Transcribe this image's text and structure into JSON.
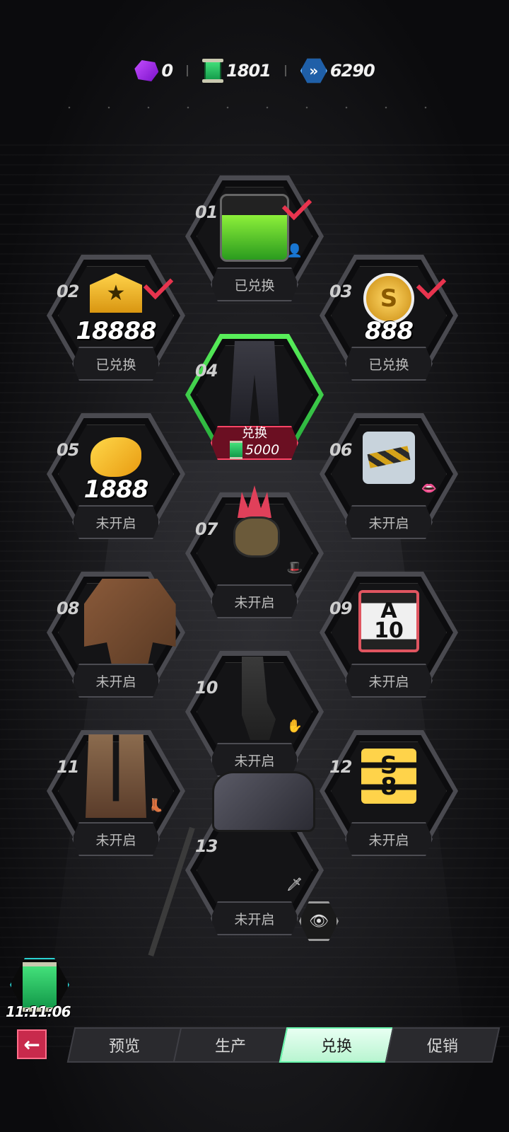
{
  "currencies": [
    {
      "icon": "purple-gem-icon",
      "value": "0"
    },
    {
      "icon": "green-scroll-icon",
      "value": "1801"
    },
    {
      "icon": "blue-chevron-token-icon",
      "value": "6290"
    }
  ],
  "items": [
    {
      "num": "01",
      "status": "已兑换",
      "art": "green-beaker",
      "checked": true
    },
    {
      "num": "02",
      "status": "已兑换",
      "art": "gold-star-badge",
      "amount": "18888",
      "checked": true
    },
    {
      "num": "03",
      "status": "已兑换",
      "art": "gold-s-coin",
      "amount": "888",
      "checked": true
    },
    {
      "num": "04",
      "status": "兑换",
      "price": "5000",
      "art": "pants",
      "active": true
    },
    {
      "num": "05",
      "status": "未开启",
      "art": "golden-fish",
      "amount": "1888"
    },
    {
      "num": "06",
      "status": "未开启",
      "art": "tape-card"
    },
    {
      "num": "07",
      "status": "未开启",
      "art": "spiky-mask"
    },
    {
      "num": "08",
      "status": "未开启",
      "art": "jacket"
    },
    {
      "num": "09",
      "status": "未开启",
      "art": "rank-card",
      "card_letter": "A",
      "card_num": "10"
    },
    {
      "num": "10",
      "status": "未开启",
      "art": "glove"
    },
    {
      "num": "11",
      "status": "未开启",
      "art": "boots"
    },
    {
      "num": "12",
      "status": "未开启",
      "art": "s-badge",
      "card_letter": "S",
      "card_num": "8"
    },
    {
      "num": "13",
      "status": "未开启",
      "art": "hammer"
    }
  ],
  "timer": "11:11:06",
  "tabs": [
    "预览",
    "生产",
    "兑换",
    "促销"
  ],
  "active_tab": "兑换",
  "colors": {
    "accent_green": "#59f05a",
    "accent_red": "#e8344e",
    "tab_active": "#b9f5d1"
  }
}
